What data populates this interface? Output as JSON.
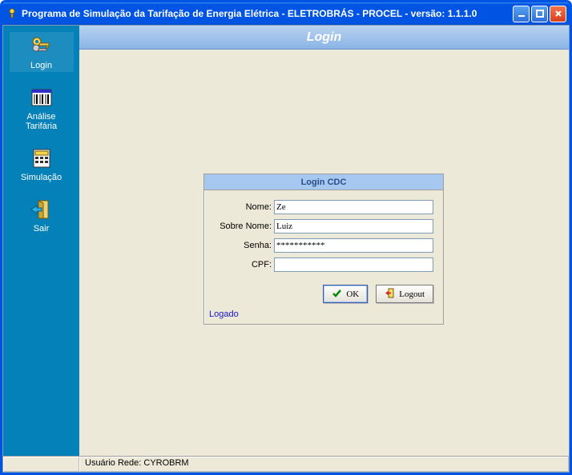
{
  "window": {
    "title": "Programa de Simulação da Tarifação de Energia Elétrica - ELETROBRÁS - PROCEL - versão: 1.1.1.0"
  },
  "sidebar": {
    "items": [
      {
        "key": "login",
        "label": "Login"
      },
      {
        "key": "analise",
        "label": "Análise Tarifária"
      },
      {
        "key": "simulacao",
        "label": "Simulação"
      },
      {
        "key": "sair",
        "label": "Sair"
      }
    ]
  },
  "header": {
    "title": "Login"
  },
  "login_panel": {
    "title": "Login CDC",
    "fields": {
      "nome_label": "Nome:",
      "nome_value": "Ze",
      "sobrenome_label": "Sobre Nome:",
      "sobrenome_value": "Luiz",
      "senha_label": "Senha:",
      "senha_value": "***********",
      "cpf_label": "CPF:",
      "cpf_value": ""
    },
    "buttons": {
      "ok": "OK",
      "logout": "Logout"
    },
    "status": "Logado"
  },
  "statusbar": {
    "user": "Usuário Rede: CYROBRM"
  }
}
